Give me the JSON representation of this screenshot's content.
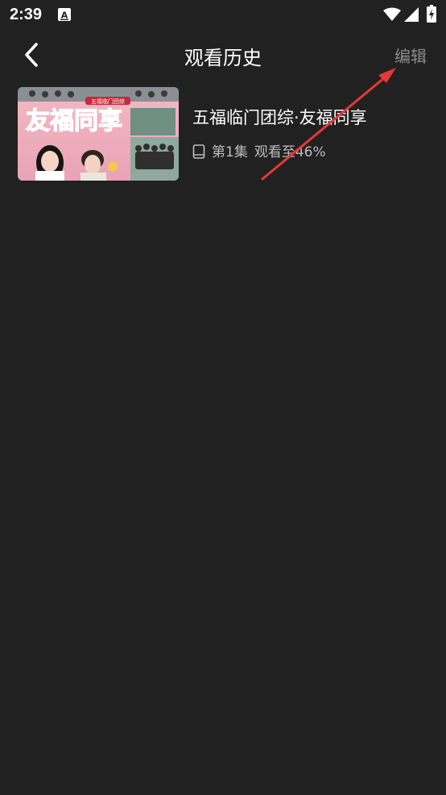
{
  "status_bar": {
    "time": "2:39",
    "icons": [
      "text-a-icon",
      "wifi-icon",
      "signal-icon",
      "battery-icon"
    ]
  },
  "header": {
    "back_icon": "chevron-left-icon",
    "title": "观看历史",
    "edit_label": "编辑"
  },
  "history": [
    {
      "title": "五福临门团综·友福同享",
      "episode": "第1集",
      "progress_text": "观看至46%",
      "progress": 0.46,
      "device_icon": "tablet-icon",
      "thumbnail": {
        "banner": "五福临门团综",
        "headline": "友福同享"
      }
    }
  ],
  "colors": {
    "background": "#212121",
    "edit_text": "#8c8c8c",
    "annotation_arrow": "#e53935"
  }
}
